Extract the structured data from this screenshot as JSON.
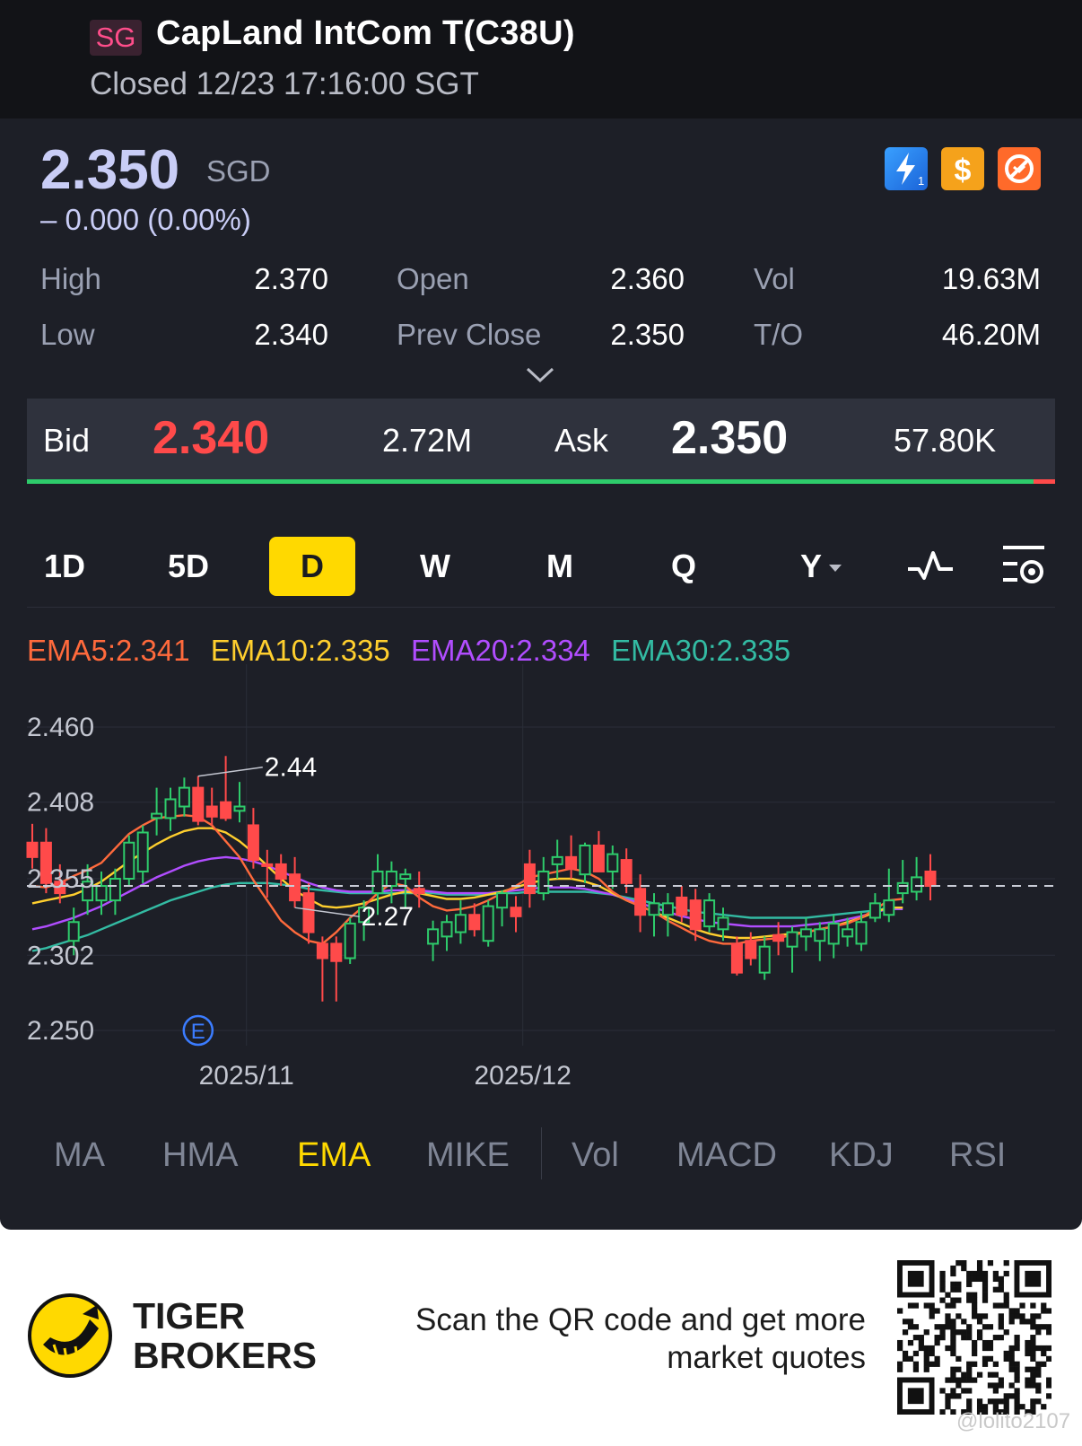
{
  "header": {
    "market_tag": "SG",
    "title": "CapLand IntCom T(C38U)",
    "status": "Closed 12/23 17:16:00 SGT"
  },
  "quote": {
    "price": "2.350",
    "currency": "SGD",
    "change": "– 0.000 (0.00%)",
    "stats": [
      {
        "label": "High",
        "value": "2.370"
      },
      {
        "label": "Open",
        "value": "2.360"
      },
      {
        "label": "Vol",
        "value": "19.63M"
      },
      {
        "label": "Low",
        "value": "2.340"
      },
      {
        "label": "Prev Close",
        "value": "2.350"
      },
      {
        "label": "T/O",
        "value": "46.20M"
      }
    ],
    "badges": [
      "lightning-icon",
      "dollar-icon",
      "no-short-icon"
    ]
  },
  "bidask": {
    "bid_label": "Bid",
    "bid_price": "2.340",
    "bid_size": "2.72M",
    "ask_label": "Ask",
    "ask_price": "2.350",
    "ask_size": "57.80K"
  },
  "periods": [
    "1D",
    "5D",
    "D",
    "W",
    "M",
    "Q",
    "Y"
  ],
  "active_period": "D",
  "ema_legend": {
    "ema5": "EMA5:2.341",
    "ema10": "EMA10:2.335",
    "ema20": "EMA20:2.334",
    "ema30": "EMA30:2.335"
  },
  "colors": {
    "up": "#2ecb6b",
    "down": "#ff4a4a",
    "ema5": "#ff6a3c",
    "ema10": "#ffcf2e",
    "ema20": "#b14dff",
    "ema30": "#33bba3",
    "accent": "#ffd900"
  },
  "chart_data": {
    "type": "candlestick",
    "y_ticks": [
      "2.460",
      "2.408",
      "2.355",
      "2.302",
      "2.250"
    ],
    "ylim": [
      2.25,
      2.46
    ],
    "x_ticks": [
      {
        "label": "2025/11",
        "index": 15.5
      },
      {
        "label": "2025/12",
        "index": 35.5
      }
    ],
    "annotations": [
      {
        "text": "2.44",
        "index": 12
      },
      {
        "text": "2.27",
        "index": 19
      }
    ],
    "earnings_marker": {
      "text": "E",
      "index": 12
    },
    "current_price": 2.35,
    "candles": [
      {
        "o": 2.38,
        "h": 2.393,
        "l": 2.362,
        "c": 2.37
      },
      {
        "o": 2.38,
        "h": 2.39,
        "l": 2.345,
        "c": 2.352
      },
      {
        "o": 2.353,
        "h": 2.365,
        "l": 2.338,
        "c": 2.345
      },
      {
        "o": 2.312,
        "h": 2.335,
        "l": 2.302,
        "c": 2.325
      },
      {
        "o": 2.34,
        "h": 2.365,
        "l": 2.33,
        "c": 2.353
      },
      {
        "o": 2.34,
        "h": 2.36,
        "l": 2.33,
        "c": 2.35
      },
      {
        "o": 2.34,
        "h": 2.362,
        "l": 2.33,
        "c": 2.355
      },
      {
        "o": 2.355,
        "h": 2.385,
        "l": 2.35,
        "c": 2.38
      },
      {
        "o": 2.36,
        "h": 2.392,
        "l": 2.352,
        "c": 2.387
      },
      {
        "o": 2.397,
        "h": 2.418,
        "l": 2.385,
        "c": 2.4
      },
      {
        "o": 2.397,
        "h": 2.418,
        "l": 2.388,
        "c": 2.41
      },
      {
        "o": 2.405,
        "h": 2.425,
        "l": 2.398,
        "c": 2.418
      },
      {
        "o": 2.418,
        "h": 2.426,
        "l": 2.392,
        "c": 2.395
      },
      {
        "o": 2.405,
        "h": 2.418,
        "l": 2.392,
        "c": 2.398
      },
      {
        "o": 2.408,
        "h": 2.44,
        "l": 2.395,
        "c": 2.397
      },
      {
        "o": 2.402,
        "h": 2.422,
        "l": 2.394,
        "c": 2.405
      },
      {
        "o": 2.392,
        "h": 2.404,
        "l": 2.362,
        "c": 2.368
      },
      {
        "o": 2.365,
        "h": 2.375,
        "l": 2.342,
        "c": 2.364
      },
      {
        "o": 2.365,
        "h": 2.372,
        "l": 2.35,
        "c": 2.355
      },
      {
        "o": 2.358,
        "h": 2.37,
        "l": 2.335,
        "c": 2.34
      },
      {
        "o": 2.345,
        "h": 2.352,
        "l": 2.31,
        "c": 2.318
      },
      {
        "o": 2.31,
        "h": 2.315,
        "l": 2.27,
        "c": 2.3
      },
      {
        "o": 2.31,
        "h": 2.315,
        "l": 2.27,
        "c": 2.298
      },
      {
        "o": 2.3,
        "h": 2.328,
        "l": 2.296,
        "c": 2.324
      },
      {
        "o": 2.325,
        "h": 2.34,
        "l": 2.312,
        "c": 2.335
      },
      {
        "o": 2.345,
        "h": 2.372,
        "l": 2.33,
        "c": 2.36
      },
      {
        "o": 2.35,
        "h": 2.367,
        "l": 2.338,
        "c": 2.36
      },
      {
        "o": 2.355,
        "h": 2.362,
        "l": 2.335,
        "c": 2.358
      },
      {
        "o": 2.348,
        "h": 2.36,
        "l": 2.335,
        "c": 2.345
      },
      {
        "o": 2.31,
        "h": 2.326,
        "l": 2.298,
        "c": 2.32
      },
      {
        "o": 2.315,
        "h": 2.33,
        "l": 2.305,
        "c": 2.325
      },
      {
        "o": 2.318,
        "h": 2.34,
        "l": 2.31,
        "c": 2.33
      },
      {
        "o": 2.33,
        "h": 2.338,
        "l": 2.315,
        "c": 2.32
      },
      {
        "o": 2.312,
        "h": 2.34,
        "l": 2.308,
        "c": 2.336
      },
      {
        "o": 2.335,
        "h": 2.347,
        "l": 2.322,
        "c": 2.345
      },
      {
        "o": 2.335,
        "h": 2.343,
        "l": 2.318,
        "c": 2.329
      },
      {
        "o": 2.365,
        "h": 2.375,
        "l": 2.335,
        "c": 2.345
      },
      {
        "o": 2.345,
        "h": 2.37,
        "l": 2.34,
        "c": 2.36
      },
      {
        "o": 2.365,
        "h": 2.382,
        "l": 2.355,
        "c": 2.37
      },
      {
        "o": 2.37,
        "h": 2.385,
        "l": 2.355,
        "c": 2.362
      },
      {
        "o": 2.358,
        "h": 2.38,
        "l": 2.352,
        "c": 2.378
      },
      {
        "o": 2.378,
        "h": 2.388,
        "l": 2.36,
        "c": 2.36
      },
      {
        "o": 2.36,
        "h": 2.378,
        "l": 2.348,
        "c": 2.372
      },
      {
        "o": 2.368,
        "h": 2.376,
        "l": 2.345,
        "c": 2.352
      },
      {
        "o": 2.348,
        "h": 2.358,
        "l": 2.318,
        "c": 2.33
      },
      {
        "o": 2.33,
        "h": 2.345,
        "l": 2.315,
        "c": 2.338
      },
      {
        "o": 2.33,
        "h": 2.345,
        "l": 2.315,
        "c": 2.338
      },
      {
        "o": 2.342,
        "h": 2.35,
        "l": 2.325,
        "c": 2.33
      },
      {
        "o": 2.34,
        "h": 2.348,
        "l": 2.312,
        "c": 2.32
      },
      {
        "o": 2.322,
        "h": 2.345,
        "l": 2.318,
        "c": 2.34
      },
      {
        "o": 2.32,
        "h": 2.335,
        "l": 2.312,
        "c": 2.328
      },
      {
        "o": 2.31,
        "h": 2.315,
        "l": 2.288,
        "c": 2.29
      },
      {
        "o": 2.312,
        "h": 2.318,
        "l": 2.295,
        "c": 2.3
      },
      {
        "o": 2.29,
        "h": 2.315,
        "l": 2.285,
        "c": 2.308
      },
      {
        "o": 2.316,
        "h": 2.325,
        "l": 2.302,
        "c": 2.312
      },
      {
        "o": 2.308,
        "h": 2.322,
        "l": 2.29,
        "c": 2.318
      },
      {
        "o": 2.315,
        "h": 2.328,
        "l": 2.305,
        "c": 2.32
      },
      {
        "o": 2.312,
        "h": 2.325,
        "l": 2.298,
        "c": 2.32
      },
      {
        "o": 2.31,
        "h": 2.33,
        "l": 2.3,
        "c": 2.324
      },
      {
        "o": 2.315,
        "h": 2.328,
        "l": 2.308,
        "c": 2.32
      },
      {
        "o": 2.31,
        "h": 2.332,
        "l": 2.305,
        "c": 2.325
      },
      {
        "o": 2.328,
        "h": 2.345,
        "l": 2.325,
        "c": 2.338
      },
      {
        "o": 2.33,
        "h": 2.362,
        "l": 2.325,
        "c": 2.34
      },
      {
        "o": 2.345,
        "h": 2.368,
        "l": 2.338,
        "c": 2.352
      },
      {
        "o": 2.346,
        "h": 2.37,
        "l": 2.34,
        "c": 2.356
      },
      {
        "o": 2.36,
        "h": 2.372,
        "l": 2.34,
        "c": 2.35
      }
    ],
    "ema5": [
      2.35,
      2.349,
      2.352,
      2.357,
      2.361,
      2.366,
      2.376,
      2.386,
      2.392,
      2.397,
      2.398,
      2.399,
      2.398,
      2.392,
      2.381,
      2.37,
      2.354,
      2.34,
      2.326,
      2.318,
      2.312,
      2.31,
      2.318,
      2.328,
      2.336,
      2.345,
      2.352,
      2.35,
      2.342,
      2.336,
      2.333,
      2.334,
      2.336,
      2.34,
      2.345,
      2.35,
      2.356,
      2.358,
      2.36,
      2.362,
      2.36,
      2.355,
      2.346,
      2.34,
      2.336,
      2.332,
      2.326,
      2.321,
      2.316,
      2.312,
      2.31,
      2.31,
      2.312,
      2.313,
      2.314,
      2.316,
      2.318,
      2.32,
      2.322,
      2.324,
      2.328,
      2.334,
      2.34,
      2.341
    ],
    "ema10": [
      2.338,
      2.34,
      2.342,
      2.344,
      2.348,
      2.353,
      2.36,
      2.367,
      2.373,
      2.379,
      2.384,
      2.388,
      2.39,
      2.39,
      2.387,
      2.381,
      2.373,
      2.364,
      2.355,
      2.347,
      2.341,
      2.336,
      2.335,
      2.336,
      2.338,
      2.341,
      2.344,
      2.346,
      2.345,
      2.343,
      2.341,
      2.341,
      2.342,
      2.344,
      2.346,
      2.349,
      2.352,
      2.354,
      2.355,
      2.355,
      2.353,
      2.35,
      2.345,
      2.34,
      2.336,
      2.332,
      2.328,
      2.324,
      2.32,
      2.317,
      2.315,
      2.314,
      2.314,
      2.315,
      2.316,
      2.317,
      2.318,
      2.32,
      2.322,
      2.325,
      2.328,
      2.332,
      2.335,
      2.335
    ],
    "ema20": [
      2.32,
      2.322,
      2.325,
      2.328,
      2.332,
      2.336,
      2.341,
      2.346,
      2.351,
      2.356,
      2.36,
      2.364,
      2.367,
      2.369,
      2.37,
      2.369,
      2.367,
      2.364,
      2.36,
      2.356,
      2.352,
      2.349,
      2.347,
      2.346,
      2.346,
      2.346,
      2.347,
      2.347,
      2.347,
      2.346,
      2.345,
      2.345,
      2.345,
      2.345,
      2.346,
      2.347,
      2.348,
      2.349,
      2.349,
      2.349,
      2.348,
      2.346,
      2.344,
      2.341,
      2.338,
      2.335,
      2.332,
      2.329,
      2.327,
      2.325,
      2.324,
      2.323,
      2.322,
      2.322,
      2.322,
      2.322,
      2.323,
      2.324,
      2.325,
      2.327,
      2.329,
      2.332,
      2.334,
      2.334
    ],
    "ema30": [
      2.305,
      2.307,
      2.31,
      2.313,
      2.316,
      2.32,
      2.324,
      2.328,
      2.332,
      2.336,
      2.34,
      2.343,
      2.346,
      2.349,
      2.351,
      2.352,
      2.352,
      2.352,
      2.351,
      2.35,
      2.348,
      2.347,
      2.346,
      2.345,
      2.345,
      2.345,
      2.345,
      2.345,
      2.345,
      2.345,
      2.344,
      2.344,
      2.344,
      2.344,
      2.345,
      2.345,
      2.346,
      2.346,
      2.346,
      2.346,
      2.346,
      2.345,
      2.344,
      2.342,
      2.34,
      2.338,
      2.336,
      2.334,
      2.332,
      2.331,
      2.33,
      2.329,
      2.328,
      2.328,
      2.328,
      2.328,
      2.328,
      2.329,
      2.33,
      2.331,
      2.332,
      2.333,
      2.335,
      2.335
    ]
  },
  "indicator_tabs": [
    "MA",
    "HMA",
    "EMA",
    "MIKE",
    "Vol",
    "MACD",
    "KDJ",
    "RSI"
  ],
  "active_indicator": "EMA",
  "footer": {
    "brand_line1": "TIGER",
    "brand_line2": "BROKERS",
    "scan_line1": "Scan the QR code and get more",
    "scan_line2": "market quotes",
    "watermark": "@lolito2107"
  }
}
